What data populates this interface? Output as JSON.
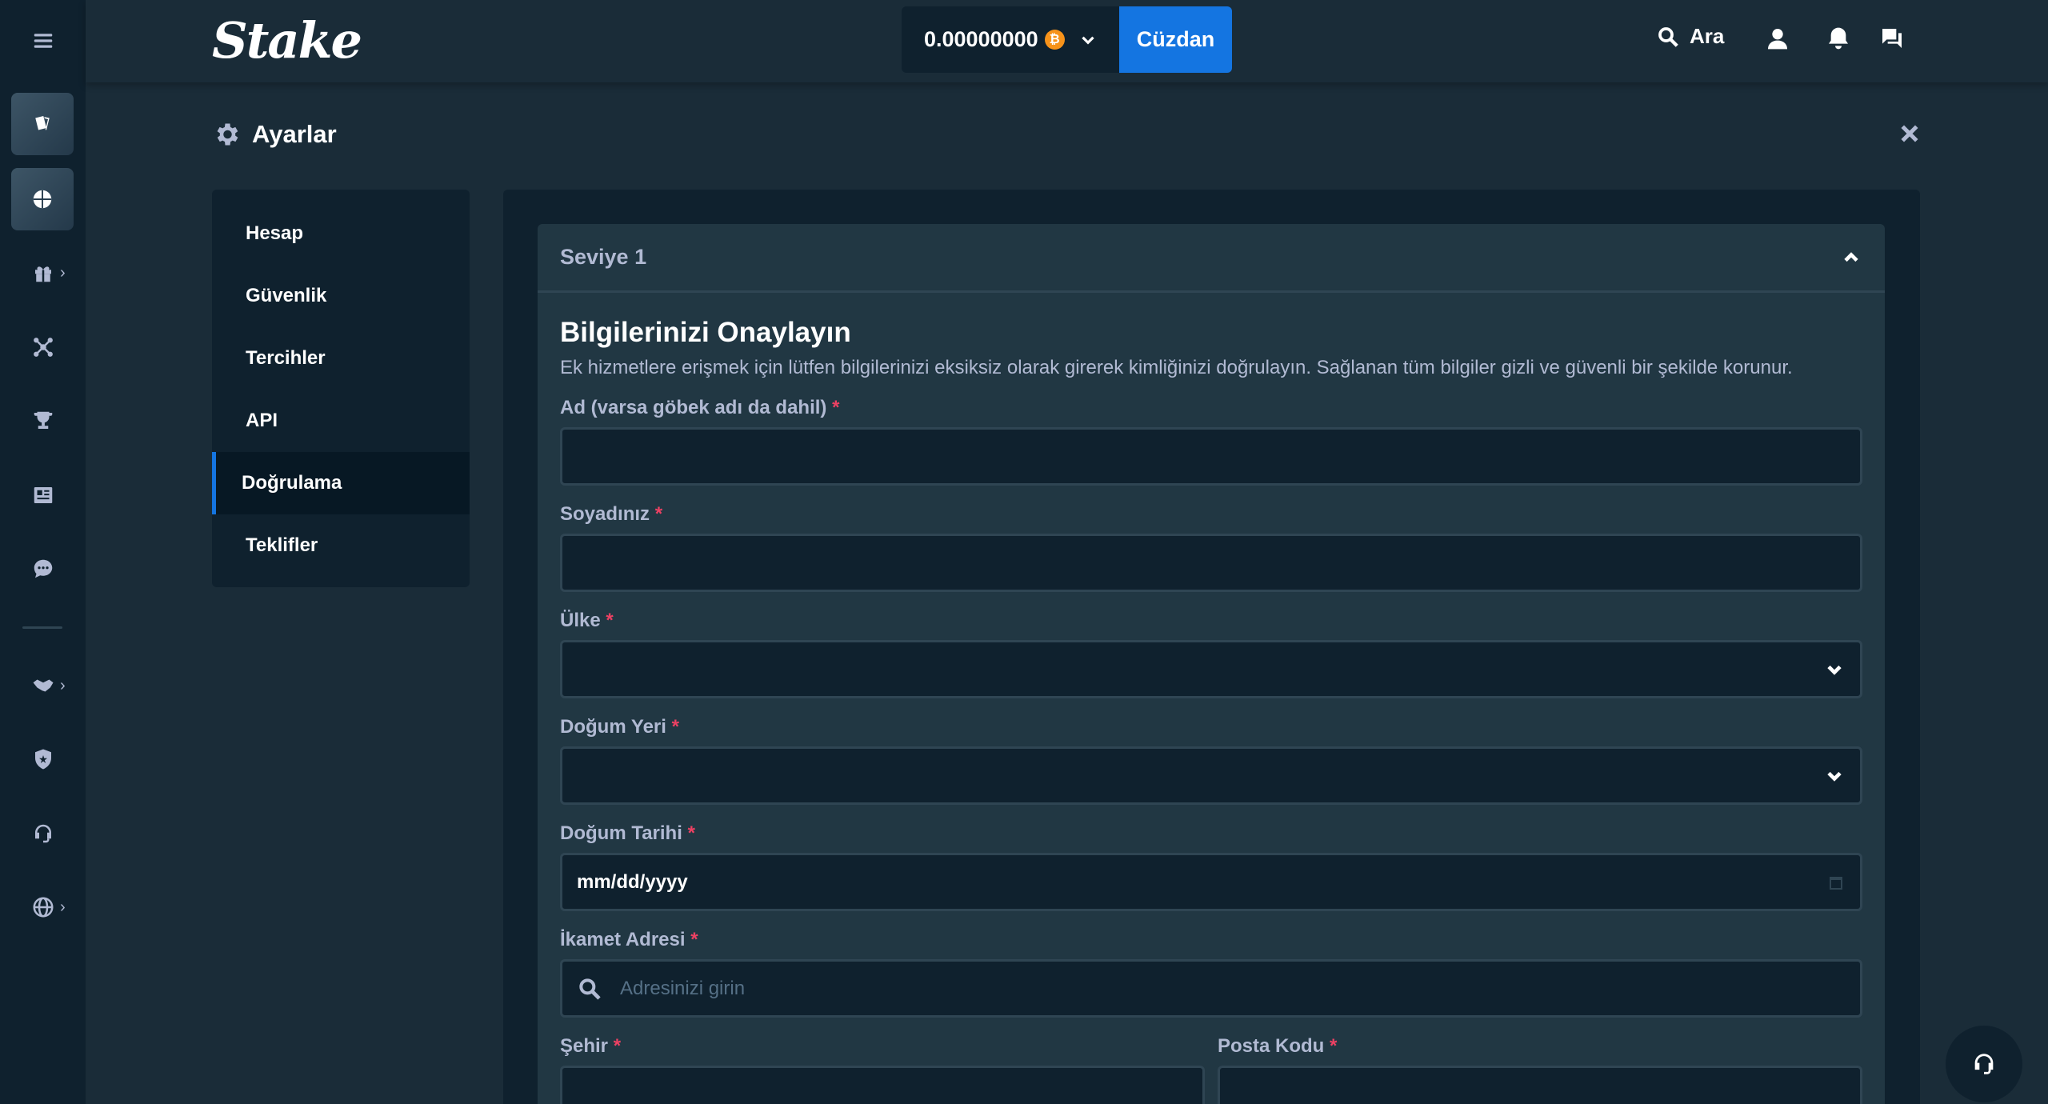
{
  "header": {
    "logo": "Stake",
    "balance": "0.00000000",
    "currency_symbol": "₿",
    "wallet_label": "Cüzdan",
    "search_label": "Ara"
  },
  "page": {
    "title": "Ayarlar"
  },
  "settings_menu": {
    "items": [
      {
        "label": "Hesap",
        "active": false
      },
      {
        "label": "Güvenlik",
        "active": false
      },
      {
        "label": "Tercihler",
        "active": false
      },
      {
        "label": "API",
        "active": false
      },
      {
        "label": "Doğrulama",
        "active": true
      },
      {
        "label": "Teklifler",
        "active": false
      }
    ]
  },
  "verification": {
    "level_label": "Seviye 1",
    "title": "Bilgilerinizi Onaylayın",
    "description": "Ek hizmetlere erişmek için lütfen bilgilerinizi eksiksiz olarak girerek kimliğinizi doğrulayın. Sağlanan tüm bilgiler gizli ve güvenli bir şekilde korunur.",
    "required_mark": "*",
    "fields": {
      "first_name": {
        "label": "Ad (varsa göbek adı da dahil)",
        "value": ""
      },
      "last_name": {
        "label": "Soyadınız",
        "value": ""
      },
      "country": {
        "label": "Ülke",
        "value": ""
      },
      "birth_place": {
        "label": "Doğum Yeri",
        "value": ""
      },
      "birth_date": {
        "label": "Doğum Tarihi",
        "value": "mm/dd/yyyy"
      },
      "address": {
        "label": "İkamet Adresi",
        "placeholder": "Adresinizi girin"
      },
      "city": {
        "label": "Şehir",
        "value": ""
      },
      "postal_code": {
        "label": "Posta Kodu",
        "value": ""
      }
    }
  },
  "colors": {
    "background": "#1a2c38",
    "sidebar": "#0f212e",
    "card": "#213743",
    "accent": "#1475e1",
    "required": "#ed4163",
    "muted_text": "#b1bad3"
  }
}
